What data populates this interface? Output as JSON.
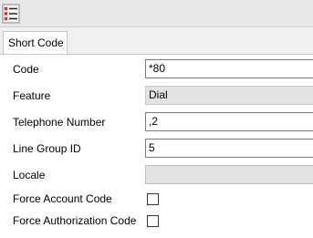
{
  "tab": {
    "label": "Short Code"
  },
  "form": {
    "code": {
      "label": "Code",
      "value": "*80"
    },
    "feature": {
      "label": "Feature",
      "value": "Dial"
    },
    "telephone_number": {
      "label": "Telephone Number",
      "value": ",2"
    },
    "line_group_id": {
      "label": "Line Group ID",
      "value": "5"
    },
    "locale": {
      "label": "Locale",
      "value": ""
    },
    "force_account_code": {
      "label": "Force Account Code",
      "checked": false
    },
    "force_authorization_code": {
      "label": "Force Authorization Code",
      "checked": false
    }
  },
  "icons": {
    "toolbar": "list-checklist-icon"
  },
  "colors": {
    "toolbar_bg": "#e8e8e8",
    "icon_red": "#d01c1c",
    "disabled_field_bg": "#e3e3e3"
  }
}
